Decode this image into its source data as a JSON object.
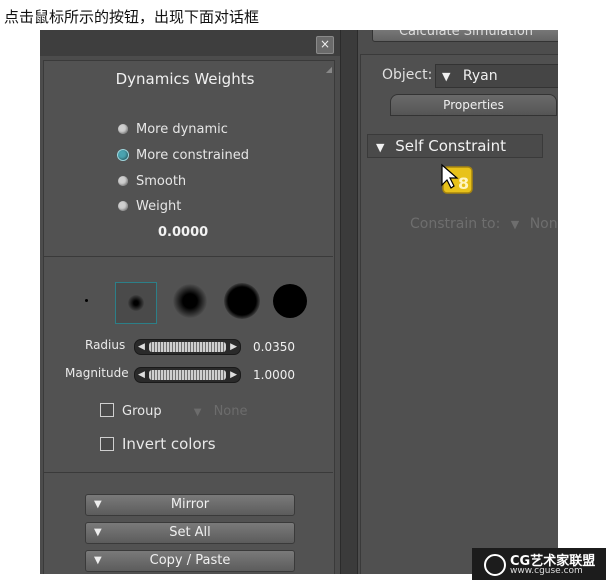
{
  "caption": "点击鼠标所示的按钮，出现下面对话框",
  "dialog": {
    "close_glyph": "×",
    "title": "Dynamics Weights",
    "radio_options": [
      {
        "label": "More dynamic",
        "selected": false
      },
      {
        "label": "More constrained",
        "selected": true
      },
      {
        "label": "Smooth",
        "selected": false
      },
      {
        "label": "Weight",
        "selected": false
      }
    ],
    "weight_value": "0.0000",
    "radius": {
      "label": "Radius",
      "value": "0.0350"
    },
    "magnitude": {
      "label": "Magnitude",
      "value": "1.0000"
    },
    "group": {
      "label": "Group",
      "value": "None",
      "checked": false
    },
    "invert_colors": {
      "label": "Invert colors",
      "checked": false
    },
    "buttons": {
      "mirror": "Mirror",
      "set_all": "Set All",
      "copy_paste": "Copy / Paste"
    }
  },
  "right_panel": {
    "calculate_button": "Calculate Simulation",
    "object_label": "Object:",
    "object_value": "Ryan",
    "properties_tab": "Properties",
    "self_constraint": "Self Constraint",
    "constrain_to_label": "Constrain to:",
    "constrain_to_value": "None"
  },
  "watermark": {
    "main": "CG艺术家联盟",
    "url": "www.cguse.com"
  },
  "colors": {
    "selection_accent": "#4aa3b0",
    "button_yellow": "#e8c21a"
  }
}
